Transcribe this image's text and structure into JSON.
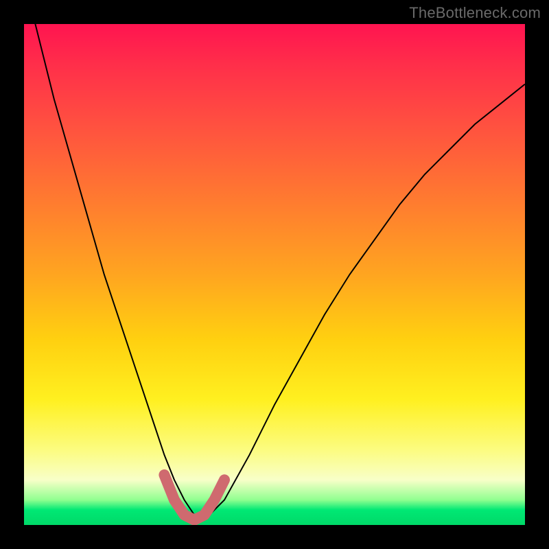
{
  "watermark": "TheBottleneck.com",
  "chart_data": {
    "type": "line",
    "title": "",
    "xlabel": "",
    "ylabel": "",
    "xlim": [
      0,
      100
    ],
    "ylim": [
      0,
      100
    ],
    "grid": false,
    "series": [
      {
        "name": "bottleneck-curve",
        "x": [
          0,
          2,
          4,
          6,
          8,
          10,
          12,
          14,
          16,
          18,
          20,
          22,
          24,
          26,
          28,
          30,
          32,
          34,
          36,
          40,
          45,
          50,
          55,
          60,
          65,
          70,
          75,
          80,
          85,
          90,
          95,
          100
        ],
        "values": [
          110,
          101,
          93,
          85,
          78,
          71,
          64,
          57,
          50,
          44,
          38,
          32,
          26,
          20,
          14,
          9,
          5,
          2,
          1,
          5,
          14,
          24,
          33,
          42,
          50,
          57,
          64,
          70,
          75,
          80,
          84,
          88
        ]
      },
      {
        "name": "optimal-zone",
        "x": [
          28,
          30,
          32,
          34,
          36,
          38,
          40
        ],
        "values": [
          10,
          5,
          2,
          1,
          2,
          5,
          9
        ]
      }
    ],
    "colors": {
      "curve": "#000000",
      "optimal_zone": "#cf6a6f",
      "gradient_top": "#ff1450",
      "gradient_bottom": "#00d968"
    }
  }
}
